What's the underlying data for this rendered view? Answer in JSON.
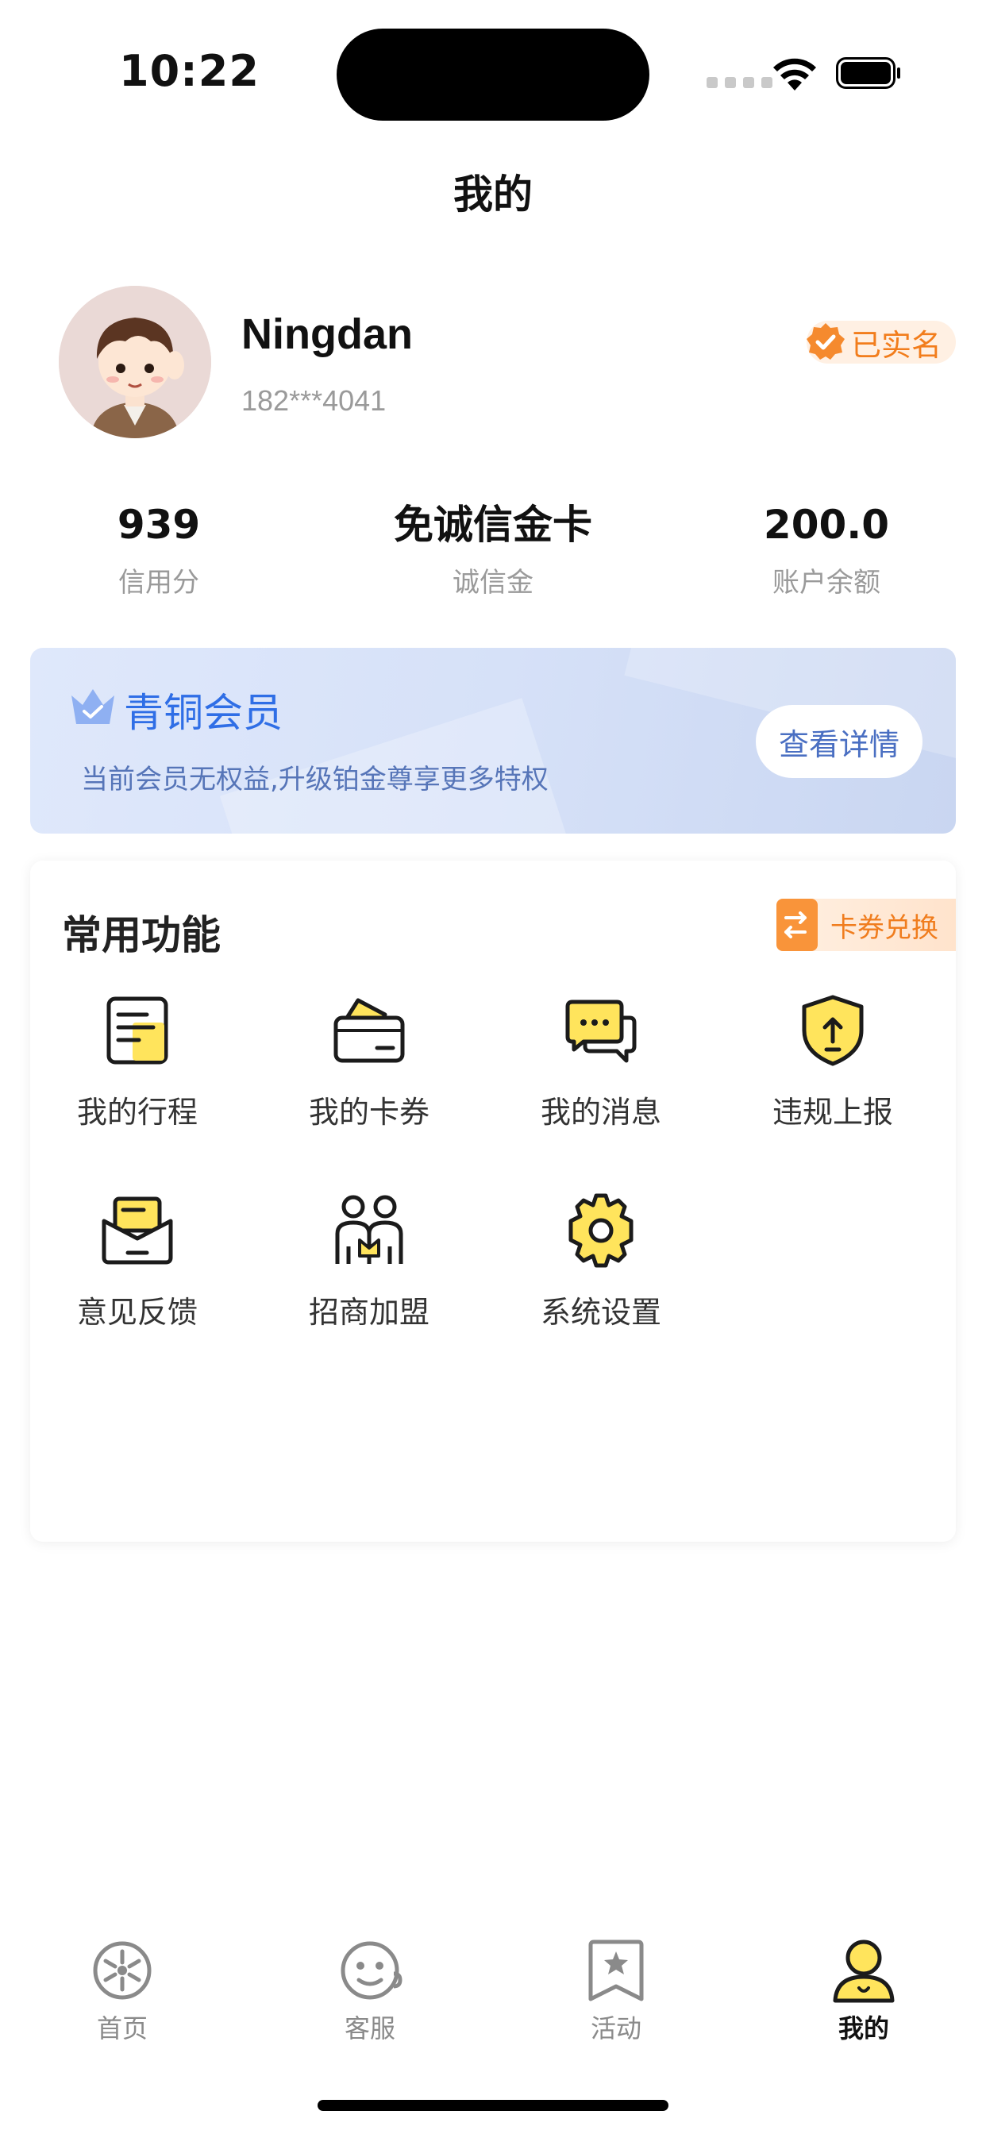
{
  "status_bar": {
    "time": "10:22"
  },
  "header": {
    "title": "我的"
  },
  "profile": {
    "name": "Ningdan",
    "phone": "182***4041",
    "verified_label": "已实名"
  },
  "stats": [
    {
      "value": "939",
      "label": "信用分"
    },
    {
      "value": "免诚信金卡",
      "label": "诚信金"
    },
    {
      "value": "200.0",
      "label": "账户余额"
    }
  ],
  "membership": {
    "title": "青铜会员",
    "subtitle": "当前会员无权益,升级铂金尊享更多特权",
    "button": "查看详情"
  },
  "features": {
    "title": "常用功能",
    "exchange_label": "卡券兑换",
    "items": [
      {
        "label": "我的行程",
        "icon": "trip-document-icon"
      },
      {
        "label": "我的卡券",
        "icon": "wallet-coupon-icon"
      },
      {
        "label": "我的消息",
        "icon": "chat-bubbles-icon"
      },
      {
        "label": "违规上报",
        "icon": "shield-upload-icon"
      },
      {
        "label": "意见反馈",
        "icon": "mail-feedback-icon"
      },
      {
        "label": "招商加盟",
        "icon": "partners-icon"
      },
      {
        "label": "系统设置",
        "icon": "gear-icon"
      }
    ]
  },
  "tabbar": {
    "items": [
      {
        "label": "首页",
        "icon": "wheel-home-icon"
      },
      {
        "label": "客服",
        "icon": "service-face-icon"
      },
      {
        "label": "活动",
        "icon": "star-bookmark-icon"
      },
      {
        "label": "我的",
        "icon": "user-profile-icon",
        "active": true
      }
    ]
  },
  "colors": {
    "accent_yellow": "#ffe45c",
    "orange": "#f27d1c",
    "member_blue": "#2f6ee6"
  }
}
